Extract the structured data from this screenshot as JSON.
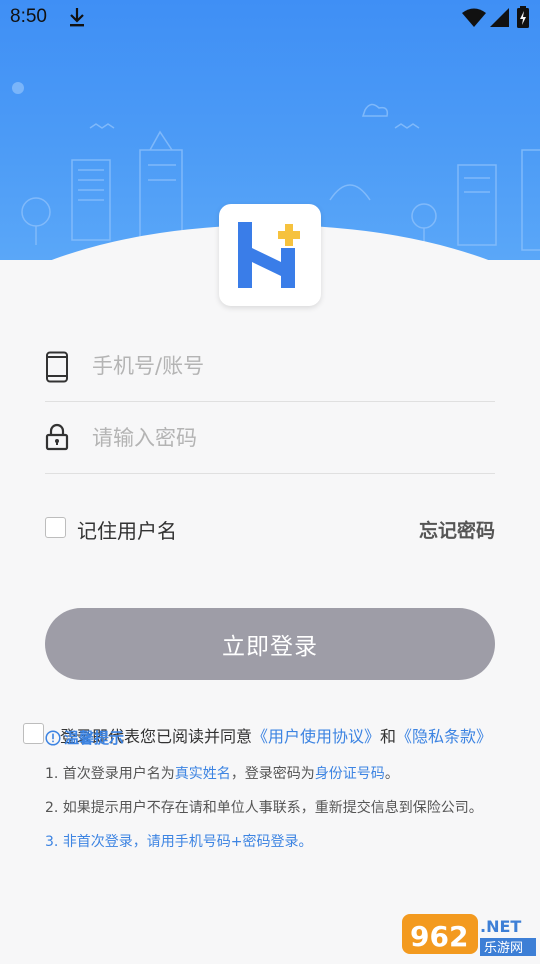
{
  "status_bar": {
    "time": "8:50"
  },
  "login": {
    "account_placeholder": "手机号/账号",
    "password_placeholder": "请输入密码",
    "remember_label": "记住用户名",
    "forgot_label": "忘记密码",
    "submit_label": "立即登录"
  },
  "agreement": {
    "prefix": "登录即代表您已阅读并同意",
    "user_agreement": "《用户使用协议》",
    "and": "和",
    "privacy_policy": "《隐私条款》"
  },
  "tips": {
    "title": "温馨提示",
    "note1_a": "1. 首次登录用户名为",
    "note1_b": "真实姓名",
    "note1_c": "，登录密码为",
    "note1_d": "身份证号码",
    "note1_e": "。",
    "note2": "2. 如果提示用户不存在请和单位人事联系，重新提交信息到保险公司。",
    "note3_num": "3. ",
    "note3": "非首次登录，请用手机号码+密码登录。"
  },
  "watermark": {
    "brand": "962",
    "suffix": ".NET",
    "site": "乐游网"
  },
  "colors": {
    "header_blue": "#4c9bf6",
    "link_blue": "#3d84e2",
    "button_gray": "#9e9da7",
    "logo_blue": "#3a7de8",
    "logo_plus": "#f6c23e"
  },
  "icons": [
    "download-icon",
    "wifi-icon",
    "signal-icon",
    "battery-icon",
    "phone-icon",
    "lock-icon",
    "info-icon"
  ]
}
